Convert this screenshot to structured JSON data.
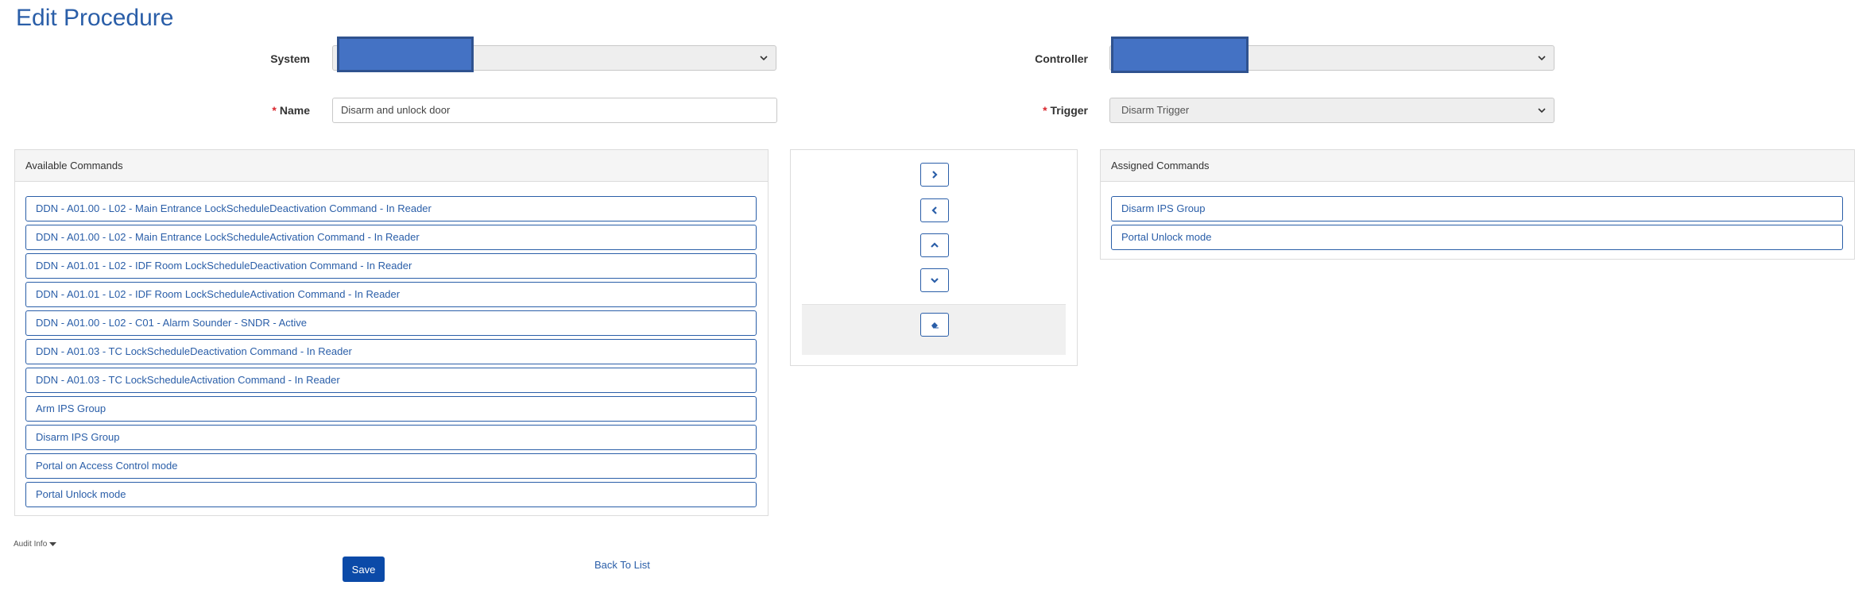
{
  "page": {
    "title": "Edit Procedure"
  },
  "form": {
    "system_label": "System",
    "controller_label": "Controller",
    "name_label": "Name",
    "name_required": "*",
    "name_value": "Disarm and unlock door",
    "trigger_label": "Trigger",
    "trigger_required": "*",
    "trigger_value": "Disarm Trigger"
  },
  "available": {
    "header": "Available Commands",
    "items": [
      "DDN - A01.00 - L02 - Main Entrance LockScheduleDeactivation Command - In Reader",
      "DDN - A01.00 - L02 - Main Entrance LockScheduleActivation Command - In Reader",
      "DDN - A01.01 - L02 - IDF Room LockScheduleDeactivation Command - In Reader",
      "DDN - A01.01 - L02 - IDF Room LockScheduleActivation Command - In Reader",
      "DDN - A01.00 - L02 - C01 - Alarm Sounder - SNDR - Active",
      "DDN - A01.03 - TC LockScheduleDeactivation Command - In Reader",
      "DDN - A01.03 - TC LockScheduleActivation Command - In Reader",
      "Arm IPS Group",
      "Disarm IPS Group",
      "Portal on Access Control mode",
      "Portal Unlock mode"
    ]
  },
  "assigned": {
    "header": "Assigned Commands",
    "items": [
      "Disarm IPS Group",
      "Portal Unlock mode"
    ]
  },
  "controls": {
    "icons": [
      "chevron-right-icon",
      "chevron-left-icon",
      "chevron-up-icon",
      "chevron-down-icon",
      "eraser-icon"
    ]
  },
  "footer": {
    "audit_label": "Audit Info",
    "save_label": "Save",
    "back_label": "Back To List"
  },
  "colors": {
    "accent": "#2a5ea8",
    "save": "#0b4aa8",
    "required": "#d9272e",
    "redaction": "#4472c4"
  }
}
